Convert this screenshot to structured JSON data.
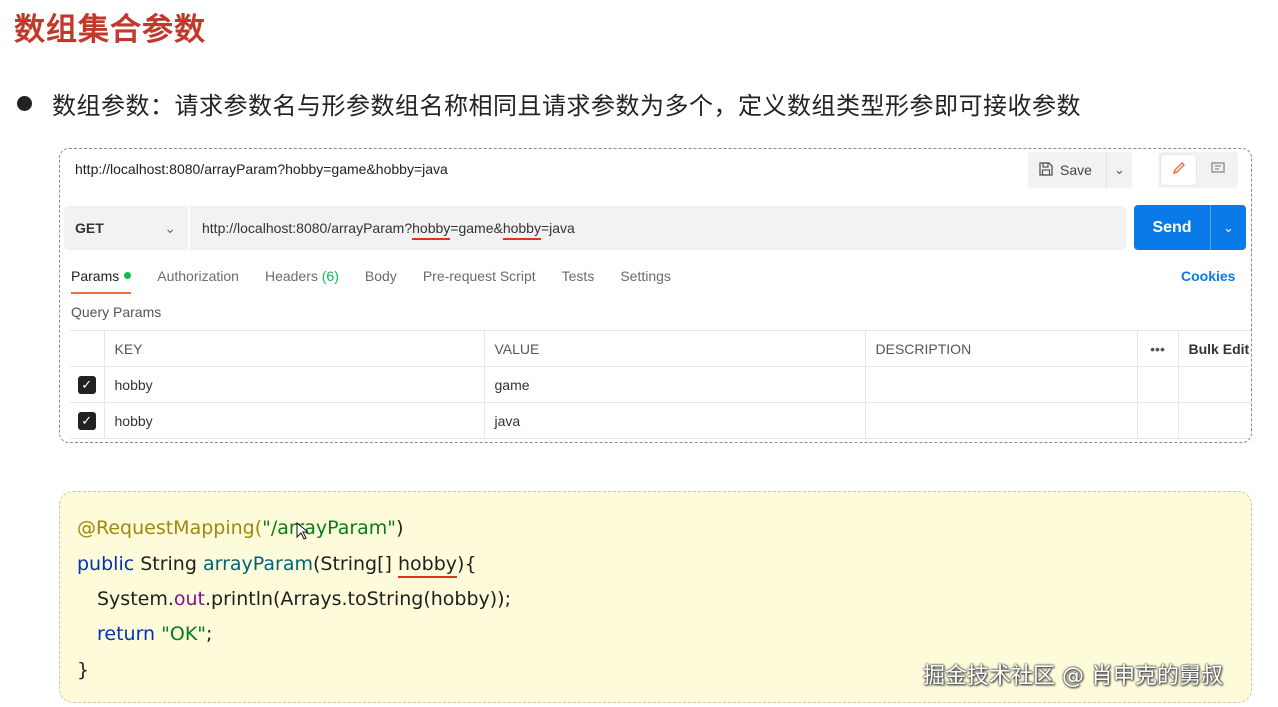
{
  "slide": {
    "title": "数组集合参数",
    "bullet": "数组参数：请求参数名与形参数组名称相同且请求参数为多个，定义数组类型形参即可接收参数"
  },
  "postman": {
    "request_title": "http://localhost:8080/arrayParam?hobby=game&hobby=java",
    "save_label": "Save",
    "method": "GET",
    "url": {
      "base": "http://localhost:8080/arrayParam?",
      "key1": "hobby",
      "mid1": "=game&",
      "key2": "hobby",
      "tail": "=java"
    },
    "send_label": "Send",
    "tabs": {
      "params": "Params",
      "authorization": "Authorization",
      "headers": "Headers",
      "headers_count": "(6)",
      "body": "Body",
      "prerequest": "Pre-request Script",
      "tests": "Tests",
      "settings": "Settings"
    },
    "cookies_label": "Cookies",
    "query_params_label": "Query Params",
    "table": {
      "headers": {
        "key": "KEY",
        "value": "VALUE",
        "description": "DESCRIPTION",
        "more": "•••",
        "bulk_edit": "Bulk Edit"
      },
      "rows": [
        {
          "checked": true,
          "key": "hobby",
          "value": "game",
          "description": ""
        },
        {
          "checked": true,
          "key": "hobby",
          "value": "java",
          "description": ""
        }
      ]
    }
  },
  "code": {
    "line1_annotation": "@RequestMapping(",
    "line1_string": "\"/arrayParam\"",
    "line1_end": ")",
    "line2_kw": "public",
    "line2_type": " String ",
    "line2_method": "arrayParam",
    "line2_params": "(String[] ",
    "line2_param_name": "hobby",
    "line2_end": "){",
    "line3_a": "System.",
    "line3_field": "out",
    "line3_b": ".println(Arrays.toString(hobby));",
    "line4_kw": "return",
    "line4_str": " \"OK\"",
    "line4_end": ";",
    "line5": "}"
  },
  "watermark": "掘金技术社区 @ 肖申克的舅叔",
  "colors": {
    "title": "#c0392b",
    "send": "#0a7ae8",
    "active_tab_underline": "#f26b3a",
    "params_dot": "#0cbb52",
    "highlight_underline": "#e0321e",
    "code_background": "#fdfbd9"
  }
}
